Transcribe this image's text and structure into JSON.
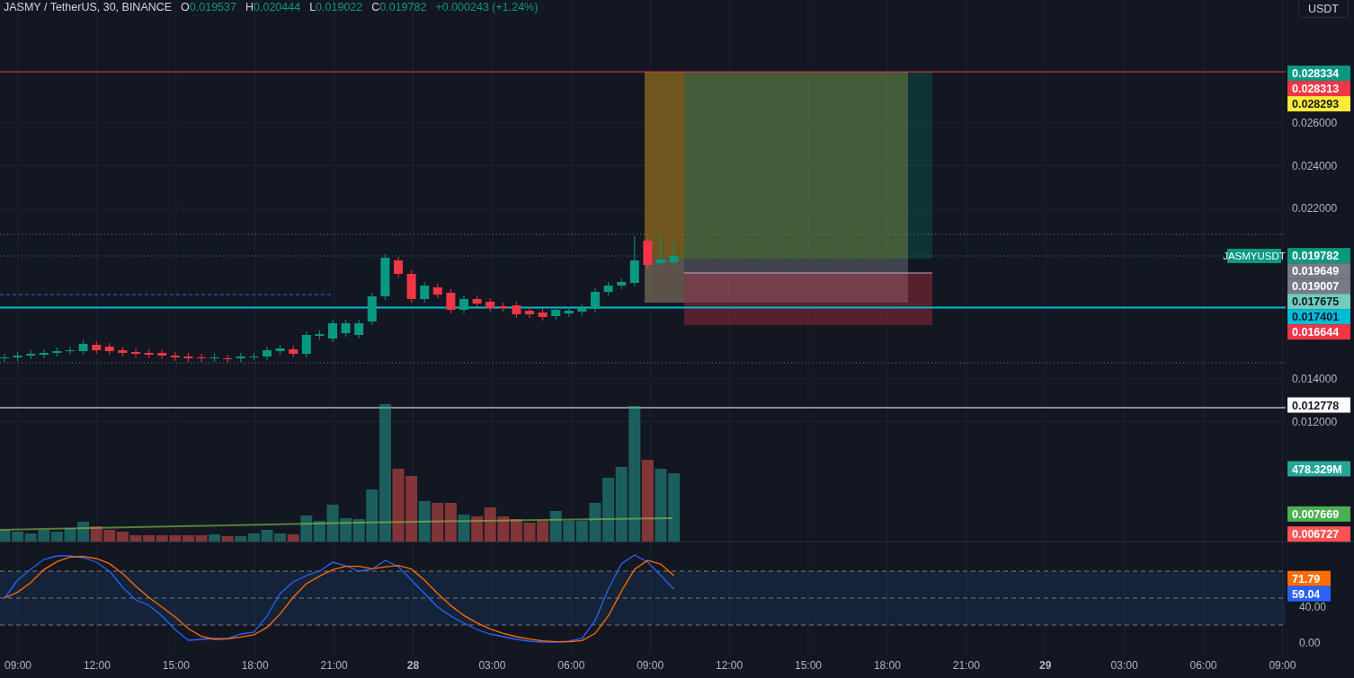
{
  "header": {
    "title": "JASMY / TetherUS, 30, BINANCE",
    "ohlc": [
      {
        "key": "O",
        "value": "0.019537"
      },
      {
        "key": "H",
        "value": "0.020444"
      },
      {
        "key": "L",
        "value": "0.019022"
      },
      {
        "key": "C",
        "value": "0.019782"
      }
    ],
    "change": "+0.000243 (+1.24%)"
  },
  "currency_button": "USDT",
  "price_axis_ticks": [
    "0.026000",
    "0.024000",
    "0.022000",
    "0.014000",
    "0.012000"
  ],
  "oscillator_axis_ticks": [
    "40.00",
    "0.00"
  ],
  "symbol_label": "JASMYUSDT",
  "price_labels": [
    {
      "text": "0.028334",
      "kind": "price",
      "color": "#089981"
    },
    {
      "text": "0.028313",
      "kind": "price",
      "color": "#f23645"
    },
    {
      "text": "0.028293",
      "kind": "price",
      "color": "#ffeb3b"
    },
    {
      "text": "0.019782",
      "kind": "price",
      "color": "#089981"
    },
    {
      "text": "0.019649",
      "kind": "price",
      "color": "#787b86"
    },
    {
      "text": "0.019007",
      "kind": "price",
      "color": "#787b86"
    },
    {
      "text": "0.017675",
      "kind": "price",
      "color": "#70ccbd"
    },
    {
      "text": "0.017401",
      "kind": "price",
      "color": "#00bcd4"
    },
    {
      "text": "0.016644",
      "kind": "price",
      "color": "#f23645"
    },
    {
      "text": "0.012778",
      "kind": "price",
      "color": "#ffffff"
    },
    {
      "text": "478.329M",
      "kind": "volume",
      "color": "#26a69a"
    },
    {
      "text": "0.007669",
      "kind": "price",
      "color": "#4caf50"
    },
    {
      "text": "0.006727",
      "kind": "price",
      "color": "#ff5252"
    },
    {
      "text": "71.79",
      "kind": "oscillator",
      "color": "#ff6d00"
    },
    {
      "text": "59.04",
      "kind": "oscillator",
      "color": "#2962ff"
    }
  ],
  "time_axis": [
    {
      "label": "09:00",
      "kind": "time"
    },
    {
      "label": "12:00",
      "kind": "time"
    },
    {
      "label": "15:00",
      "kind": "time"
    },
    {
      "label": "18:00",
      "kind": "time"
    },
    {
      "label": "21:00",
      "kind": "time"
    },
    {
      "label": "28",
      "kind": "day"
    },
    {
      "label": "03:00",
      "kind": "time"
    },
    {
      "label": "06:00",
      "kind": "time"
    },
    {
      "label": "09:00",
      "kind": "time"
    },
    {
      "label": "12:00",
      "kind": "time"
    },
    {
      "label": "15:00",
      "kind": "time"
    },
    {
      "label": "18:00",
      "kind": "time"
    },
    {
      "label": "21:00",
      "kind": "time"
    },
    {
      "label": "29",
      "kind": "day"
    },
    {
      "label": "03:00",
      "kind": "time"
    },
    {
      "label": "06:00",
      "kind": "time"
    },
    {
      "label": "09:00",
      "kind": "time"
    }
  ]
}
